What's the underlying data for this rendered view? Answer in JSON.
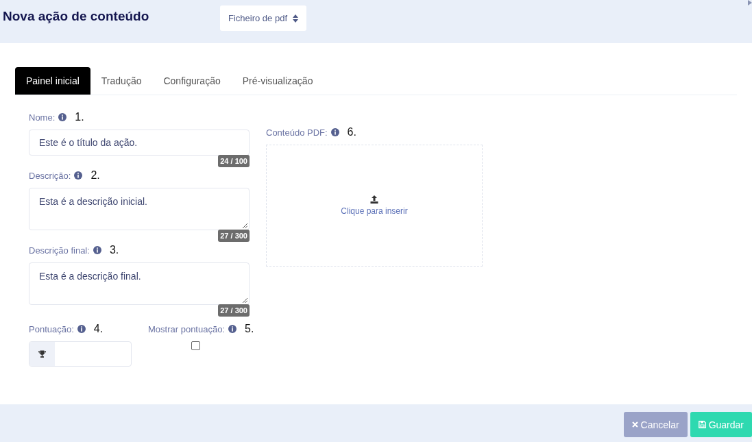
{
  "header": {
    "title": "Nova ação de conteúdo",
    "type_select": {
      "value": "Ficheiro de pdf"
    }
  },
  "tabs": [
    {
      "label": "Painel inicial",
      "selected": true
    },
    {
      "label": "Tradução",
      "selected": false
    },
    {
      "label": "Configuração",
      "selected": false
    },
    {
      "label": "Pré-visualização",
      "selected": false
    }
  ],
  "fields": [
    {
      "kind": "text",
      "label": "Nome:",
      "annotation": "1.",
      "value": "Este é o título da ação.",
      "counter": "24 / 100"
    },
    {
      "kind": "textarea",
      "label": "Descrição:",
      "annotation": "2.",
      "value": "Esta é a descrição inicial.",
      "counter": "27 / 300"
    },
    {
      "kind": "textarea",
      "label": "Descrição final:",
      "annotation": "3.",
      "value": "Esta é a descrição final.",
      "counter": "27 / 300"
    },
    {
      "kind": "score",
      "label": "Pontuação:",
      "annotation": "4."
    },
    {
      "kind": "checkbox",
      "label": "Mostrar pontuação:",
      "annotation": "5.",
      "checked": false
    }
  ],
  "pdf_upload": {
    "label": "Conteúdo PDF:",
    "annotation": "6.",
    "prompt": "Clique para inserir"
  },
  "buttons": [
    {
      "kind": "cancel",
      "label": "Cancelar"
    },
    {
      "kind": "save",
      "label": "Guardar"
    }
  ]
}
